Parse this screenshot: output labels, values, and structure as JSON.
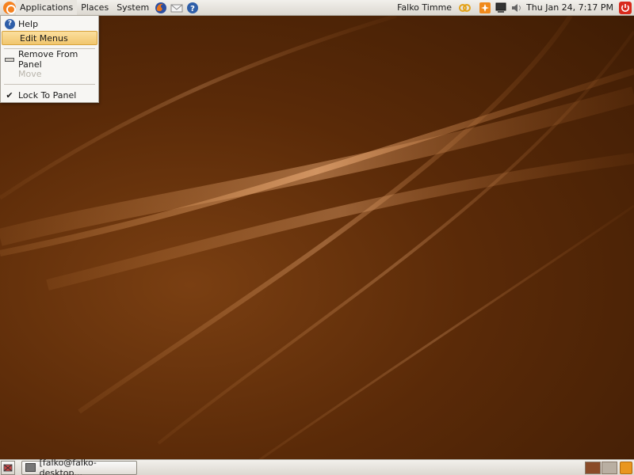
{
  "top_panel": {
    "menus": [
      "Applications",
      "Places",
      "System"
    ],
    "launchers": [
      "firefox-icon",
      "mail-icon",
      "help-icon"
    ],
    "user_name": "Falko Timme",
    "tray_icons": [
      "network-icon",
      "update-notifier-icon",
      "computer-icon",
      "volume-icon"
    ],
    "clock": "Thu Jan 24,  7:17 PM",
    "power_icon": "power-icon"
  },
  "context_menu": {
    "items": [
      {
        "label": "Help",
        "icon": "help-icon"
      },
      {
        "label": "Edit Menus",
        "icon": ""
      },
      {
        "label": "Remove From Panel",
        "icon": "remove-icon"
      },
      {
        "label": "Move",
        "icon": "",
        "disabled": true
      },
      {
        "label": "Lock To Panel",
        "icon": "check-icon"
      }
    ]
  },
  "bottom_panel": {
    "window_button": "[falko@falko-desktop..."
  },
  "colors": {
    "menu_hover": "#f1c66d",
    "wallpaper_base": "#5a2a08",
    "workspace_active": "#8a4b28"
  }
}
